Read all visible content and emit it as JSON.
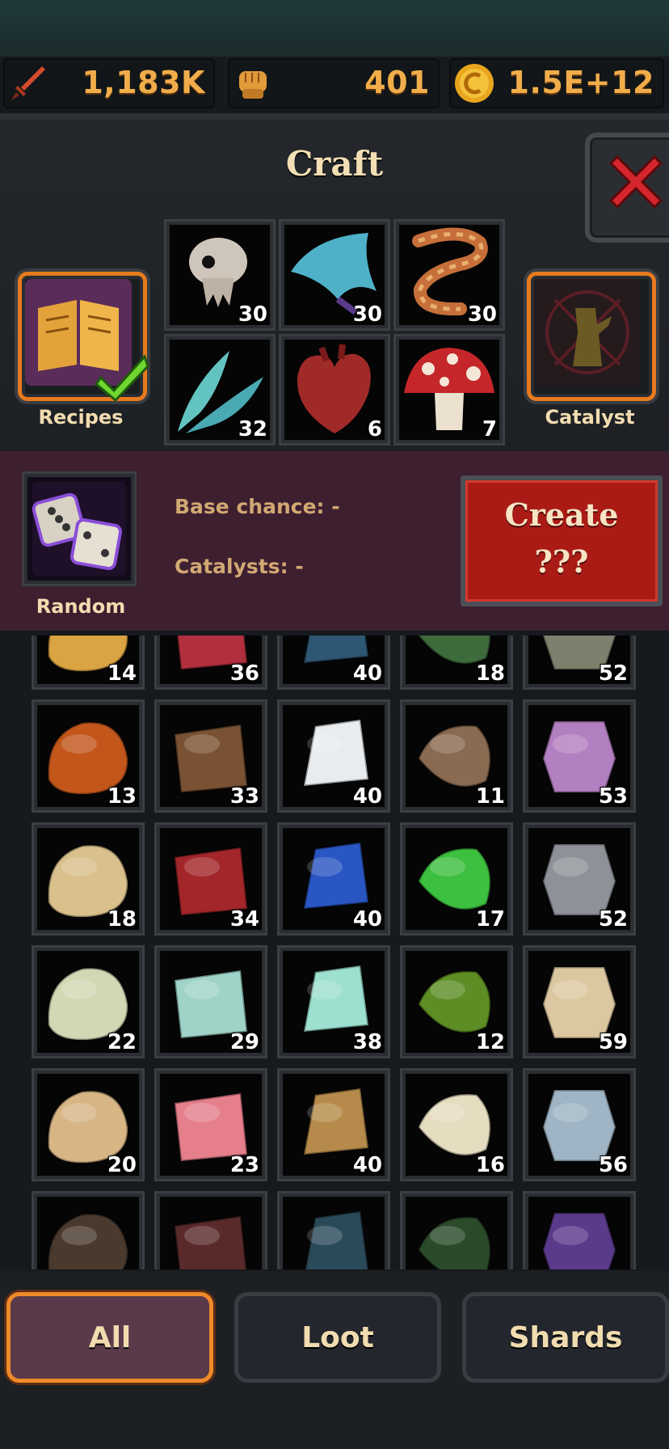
{
  "resources": [
    {
      "icon": "sword-icon",
      "value": "1,183K"
    },
    {
      "icon": "fist-icon",
      "value": "401"
    },
    {
      "icon": "coin-icon",
      "value": "1.5E+12"
    }
  ],
  "craft": {
    "title": "Craft",
    "recipes_label": "Recipes",
    "catalyst_label": "Catalyst",
    "ingredients": [
      {
        "icon": "skull-icon",
        "count": "30"
      },
      {
        "icon": "wing-icon",
        "count": "30"
      },
      {
        "icon": "tentacle-icon",
        "count": "30"
      },
      {
        "icon": "feather-icon",
        "count": "32"
      },
      {
        "icon": "heart-icon",
        "count": "6"
      },
      {
        "icon": "mushroom-icon",
        "count": "7"
      }
    ]
  },
  "random": {
    "label": "Random",
    "base_chance": "Base chance: -",
    "catalysts": "Catalysts: -",
    "create_line1": "Create",
    "create_line2": "???"
  },
  "inventory": [
    {
      "icon": "parchment-icon",
      "count": "14",
      "color": "#d9a441"
    },
    {
      "icon": "red-cloth-icon",
      "count": "36",
      "color": "#b12f3e"
    },
    {
      "icon": "blue-scroll-icon",
      "count": "40",
      "color": "#2d5772"
    },
    {
      "icon": "green-scroll-icon",
      "count": "18",
      "color": "#3e6b3c"
    },
    {
      "icon": "grey-cloth-icon",
      "count": "52",
      "color": "#7d806c"
    },
    {
      "icon": "lava-crust-icon",
      "count": "13",
      "color": "#c2561b"
    },
    {
      "icon": "leather-icon",
      "count": "33",
      "color": "#7a5233"
    },
    {
      "icon": "white-pelt-icon",
      "count": "40",
      "color": "#e8ecee"
    },
    {
      "icon": "brown-pelt-icon",
      "count": "11",
      "color": "#8a6a50"
    },
    {
      "icon": "purple-crystal-icon",
      "count": "53",
      "color": "#b27fc0"
    },
    {
      "icon": "sandstone-icon",
      "count": "18",
      "color": "#d9c08c"
    },
    {
      "icon": "ruby-ore-icon",
      "count": "34",
      "color": "#a3262a"
    },
    {
      "icon": "sapphire-icon",
      "count": "40",
      "color": "#2a56c4"
    },
    {
      "icon": "emerald-icon",
      "count": "17",
      "color": "#3dbf3f"
    },
    {
      "icon": "gravel-icon",
      "count": "52",
      "color": "#8e9298"
    },
    {
      "icon": "pale-cube-icon",
      "count": "22",
      "color": "#d2d8b4"
    },
    {
      "icon": "water-bowl-icon",
      "count": "29",
      "color": "#9fd3c7"
    },
    {
      "icon": "ice-crystal-icon",
      "count": "38",
      "color": "#9de0cf"
    },
    {
      "icon": "moss-icon",
      "count": "12",
      "color": "#5d8d24"
    },
    {
      "icon": "scroll-icon",
      "count": "59",
      "color": "#dcc8a0"
    },
    {
      "icon": "rolled-map-icon",
      "count": "20",
      "color": "#d7b585"
    },
    {
      "icon": "pink-cloth-icon",
      "count": "23",
      "color": "#e57f8c"
    },
    {
      "icon": "wax-scroll-icon",
      "count": "40",
      "color": "#b68a4a"
    },
    {
      "icon": "sealed-scroll-icon",
      "count": "16",
      "color": "#e6dcc0"
    },
    {
      "icon": "lightning-orb-icon",
      "count": "56",
      "color": "#9fb4c4"
    },
    {
      "icon": "item-icon",
      "count": "",
      "color": "#4a3a2e"
    },
    {
      "icon": "item-icon",
      "count": "",
      "color": "#5a2a2a"
    },
    {
      "icon": "item-icon",
      "count": "",
      "color": "#2a4a5a"
    },
    {
      "icon": "item-icon",
      "count": "",
      "color": "#2a4a2a"
    },
    {
      "icon": "item-icon",
      "count": "",
      "color": "#5a3a8a"
    }
  ],
  "tabs": [
    {
      "label": "All",
      "active": true
    },
    {
      "label": "Loot",
      "active": false
    },
    {
      "label": "Shards",
      "active": false
    }
  ]
}
